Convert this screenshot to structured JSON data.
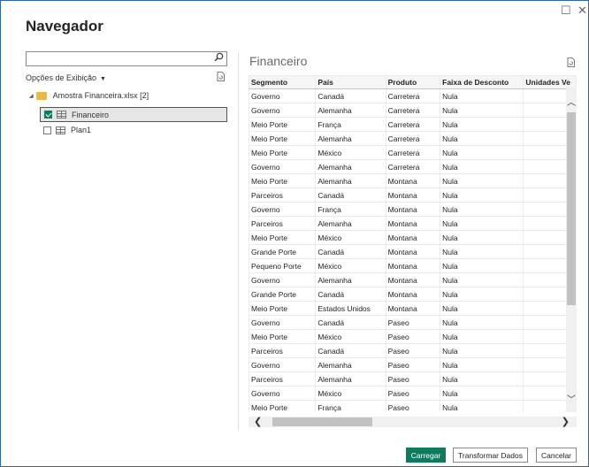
{
  "window": {
    "title": "Navegador",
    "controls": {
      "maximize": "☐",
      "close": "✕"
    }
  },
  "left": {
    "search": {
      "value": "",
      "placeholder": ""
    },
    "view_options_label": "Opções de Exibição",
    "tree": {
      "root_label": "Amostra Financeira.xlsx [2]",
      "items": [
        {
          "label": "Financeiro",
          "checked": true
        },
        {
          "label": "Plan1",
          "checked": false
        }
      ]
    }
  },
  "preview": {
    "title": "Financeiro",
    "columns": [
      "Segmento",
      "País",
      "Produto",
      "Faixa de Desconto",
      "Unidades Ve"
    ],
    "rows": [
      [
        "Governo",
        "Canadá",
        "Carretera",
        "Nula",
        ""
      ],
      [
        "Governo",
        "Alemanha",
        "Carretera",
        "Nula",
        ""
      ],
      [
        "Meio Porte",
        "França",
        "Carretera",
        "Nula",
        ""
      ],
      [
        "Meio Porte",
        "Alemanha",
        "Carretera",
        "Nula",
        ""
      ],
      [
        "Meio Porte",
        "México",
        "Carretera",
        "Nula",
        ""
      ],
      [
        "Governo",
        "Alemanha",
        "Carretera",
        "Nula",
        ""
      ],
      [
        "Meio Porte",
        "Alemanha",
        "Montana",
        "Nula",
        ""
      ],
      [
        "Parceiros",
        "Canadá",
        "Montana",
        "Nula",
        ""
      ],
      [
        "Governo",
        "França",
        "Montana",
        "Nula",
        ""
      ],
      [
        "Parceiros",
        "Alemanha",
        "Montana",
        "Nula",
        ""
      ],
      [
        "Meio Porte",
        "México",
        "Montana",
        "Nula",
        ""
      ],
      [
        "Grande Porte",
        "Canadá",
        "Montana",
        "Nula",
        ""
      ],
      [
        "Pequeno Porte",
        "México",
        "Montana",
        "Nula",
        ""
      ],
      [
        "Governo",
        "Alemanha",
        "Montana",
        "Nula",
        ""
      ],
      [
        "Grande Porte",
        "Canadá",
        "Montana",
        "Nula",
        ""
      ],
      [
        "Meio Porte",
        "Estados Unidos",
        "Montana",
        "Nula",
        ""
      ],
      [
        "Governo",
        "Canadá",
        "Paseo",
        "Nula",
        ""
      ],
      [
        "Meio Porte",
        "México",
        "Paseo",
        "Nula",
        ""
      ],
      [
        "Parceiros",
        "Canadá",
        "Paseo",
        "Nula",
        ""
      ],
      [
        "Governo",
        "Alemanha",
        "Paseo",
        "Nula",
        ""
      ],
      [
        "Parceiros",
        "Alemanha",
        "Paseo",
        "Nula",
        ""
      ],
      [
        "Governo",
        "México",
        "Paseo",
        "Nula",
        ""
      ],
      [
        "Meio Porte",
        "França",
        "Paseo",
        "Nula",
        ""
      ]
    ]
  },
  "buttons": {
    "load": "Carregar",
    "transform": "Transformar Dados",
    "cancel": "Cancelar"
  },
  "colors": {
    "accent": "#0f7b5e",
    "window_border": "#2b66b3",
    "folder": "#e8b84a"
  }
}
